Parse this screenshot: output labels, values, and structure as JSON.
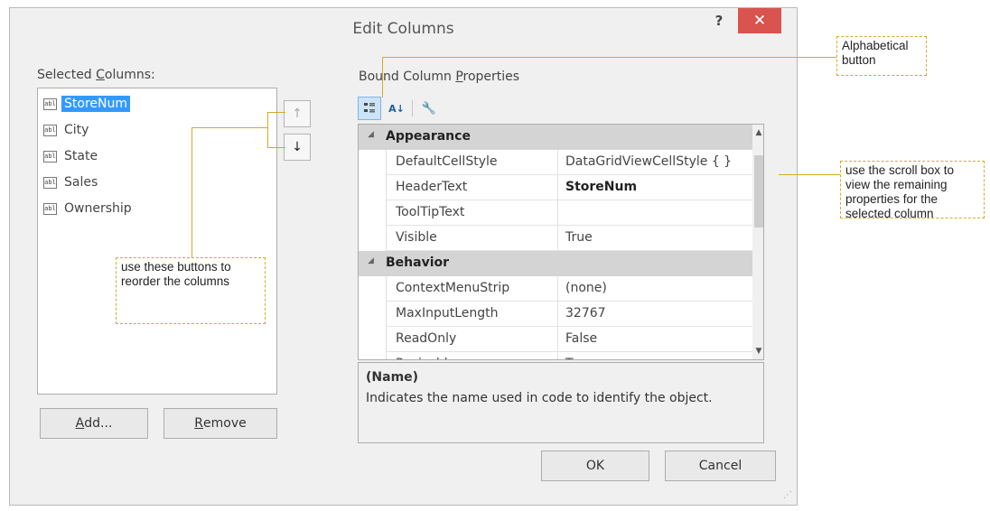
{
  "dialog": {
    "title": "Edit Columns",
    "help_label": "?",
    "close_label": "✕"
  },
  "selected_columns": {
    "label_pre": "Selected ",
    "label_ul": "C",
    "label_post": "olumns:",
    "icon_text": "abl",
    "items": [
      {
        "name": "StoreNum",
        "selected": true
      },
      {
        "name": "City",
        "selected": false
      },
      {
        "name": "State",
        "selected": false
      },
      {
        "name": "Sales",
        "selected": false
      },
      {
        "name": "Ownership",
        "selected": false
      }
    ],
    "move_up_icon": "↑",
    "move_down_icon": "↓"
  },
  "buttons": {
    "add_ul": "A",
    "add_rest": "dd...",
    "remove_ul": "R",
    "remove_rest": "emove",
    "ok": "OK",
    "cancel": "Cancel"
  },
  "properties": {
    "label_pre": "Bound Column ",
    "label_ul": "P",
    "label_post": "roperties",
    "toolbar": {
      "categorized_icon": "categorized-icon",
      "alphabetical_icon": "alphabetical-sort-icon",
      "alphabetical_text": "A↓",
      "property_pages_icon": "wrench-icon",
      "property_pages_text": "🔧"
    },
    "categories": [
      {
        "name": "Appearance",
        "rows": [
          {
            "name": "DefaultCellStyle",
            "value": "DataGridViewCellStyle { }",
            "bold": false
          },
          {
            "name": "HeaderText",
            "value": "StoreNum",
            "bold": true
          },
          {
            "name": "ToolTipText",
            "value": "",
            "bold": false
          },
          {
            "name": "Visible",
            "value": "True",
            "bold": false
          }
        ]
      },
      {
        "name": "Behavior",
        "rows": [
          {
            "name": "ContextMenuStrip",
            "value": "(none)",
            "bold": false
          },
          {
            "name": "MaxInputLength",
            "value": "32767",
            "bold": false
          },
          {
            "name": "ReadOnly",
            "value": "False",
            "bold": false
          },
          {
            "name": "Resizable",
            "value": "True",
            "bold": false
          }
        ]
      }
    ],
    "description": {
      "title": "(Name)",
      "text": "Indicates the name used in code to identify the object."
    }
  },
  "callouts": {
    "alphabetical": "Alphabetical button",
    "reorder": "use these buttons to reorder the columns",
    "scroll": "use the scroll box to view the remaining properties for the selected column"
  },
  "colors": {
    "selection": "#3399ff",
    "close_button": "#d9534f",
    "callout_border": "#d4a92a",
    "category_row": "#d4d4d4"
  }
}
